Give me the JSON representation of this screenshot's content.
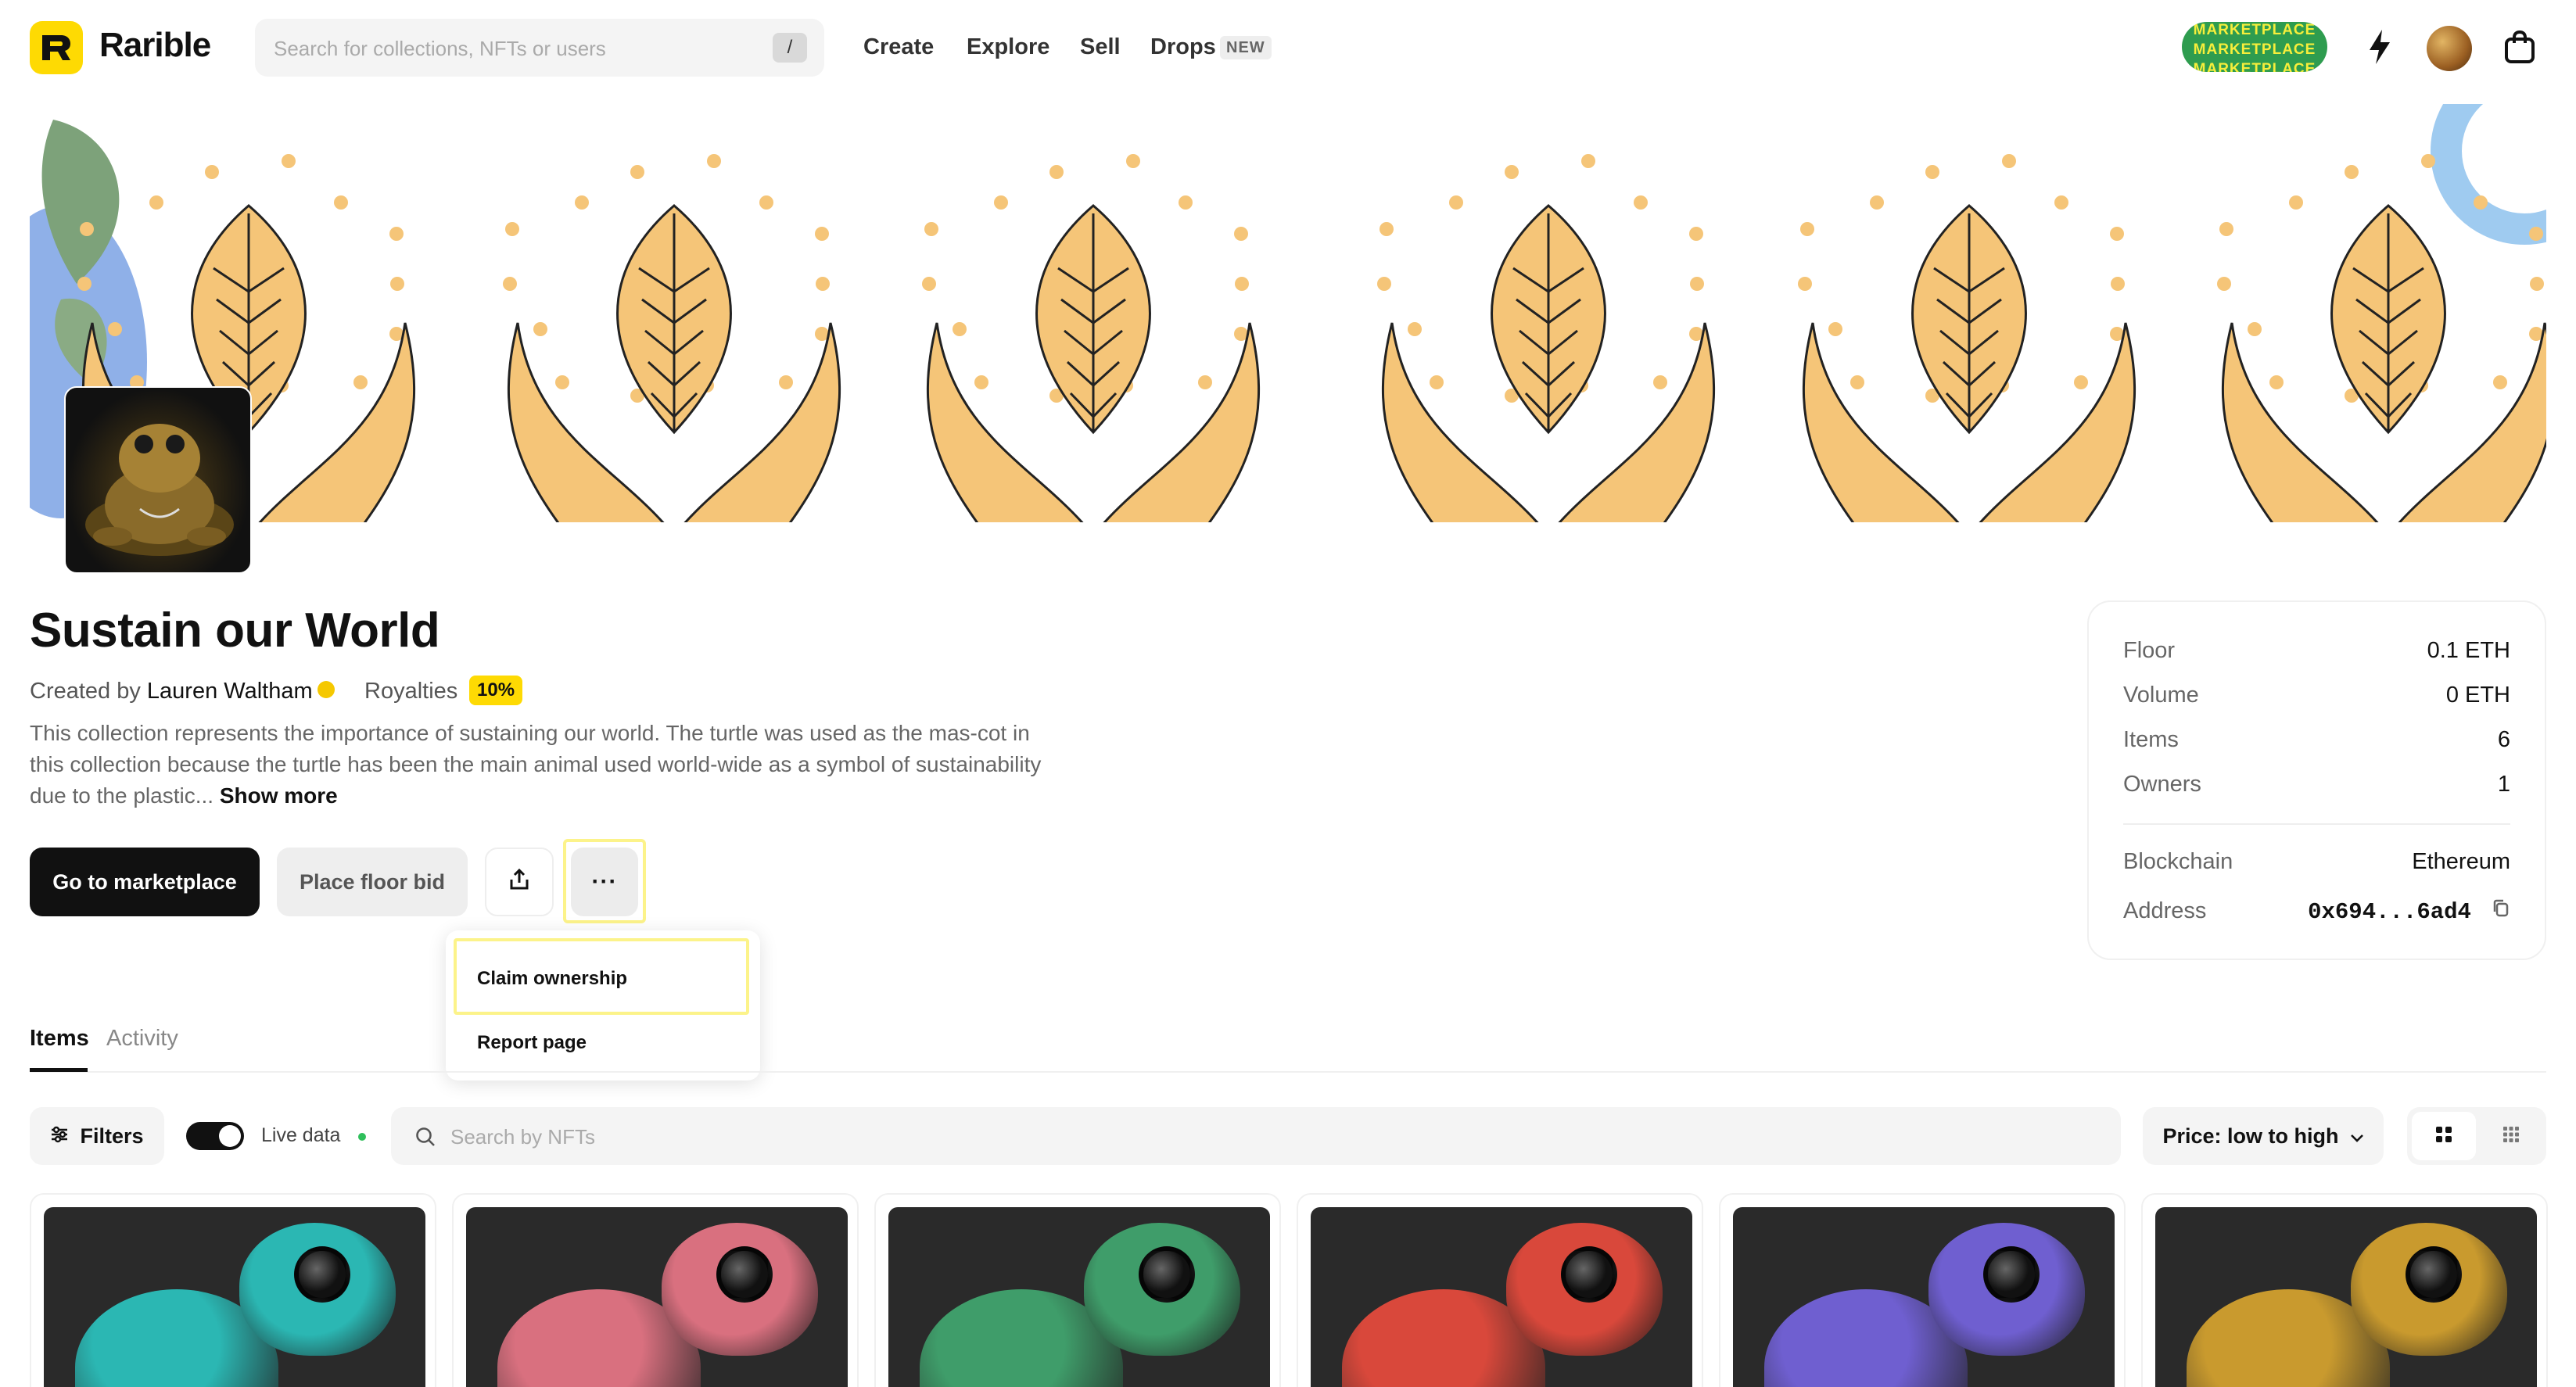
{
  "header": {
    "logo_text": "Rarible",
    "search_placeholder": "Search for collections, NFTs or users",
    "search_shortcut": "/",
    "nav": [
      "Create",
      "Explore",
      "Sell",
      "Drops"
    ],
    "drops_badge": "NEW",
    "marketplace_badge": [
      "MARKETPLACE",
      "MARKETPLACE",
      "MARKETPLACE"
    ],
    "icons": [
      "lightning-icon",
      "avatar",
      "bag-icon"
    ]
  },
  "collection": {
    "title": "Sustain our World",
    "created_by_label": "Created by",
    "creator_name": "Lauren Waltham",
    "royalties_label": "Royalties",
    "royalties_value": "10%",
    "description": "This collection represents the importance of sustaining our world. The turtle was used as the mas-cot in this collection because the turtle has been the main animal used world-wide as a symbol of sustainability due to the plastic...",
    "show_more": "Show more"
  },
  "actions": {
    "go_to_marketplace": "Go to marketplace",
    "place_floor_bid": "Place floor bid",
    "share_icon": "share-icon",
    "more_icon": "more-dots-icon",
    "more_label": "···"
  },
  "dropdown": {
    "items": [
      "Claim ownership",
      "Report page"
    ]
  },
  "stats": {
    "rows": [
      {
        "label": "Floor",
        "value": "0.1 ETH"
      },
      {
        "label": "Volume",
        "value": "0 ETH"
      },
      {
        "label": "Items",
        "value": "6"
      },
      {
        "label": "Owners",
        "value": "1"
      }
    ],
    "blockchain_label": "Blockchain",
    "blockchain_value": "Ethereum",
    "address_label": "Address",
    "address_value": "0x694...6ad4"
  },
  "tabs": [
    "Items",
    "Activity"
  ],
  "toolbar": {
    "filters": "Filters",
    "live_data": "Live data",
    "search_placeholder": "Search by NFTs",
    "sort": "Price: low to high"
  },
  "cards": [
    {
      "color": "#2bb7b3"
    },
    {
      "color": "#d9707f"
    },
    {
      "color": "#3f9d6a"
    },
    {
      "color": "#d9483b"
    },
    {
      "color": "#6f5fd0"
    },
    {
      "color": "#c99a2e"
    }
  ],
  "colors": {
    "brand_yellow": "#FEDA03",
    "banner_leaf": "#F5C578",
    "highlight": "#FCF38A"
  }
}
